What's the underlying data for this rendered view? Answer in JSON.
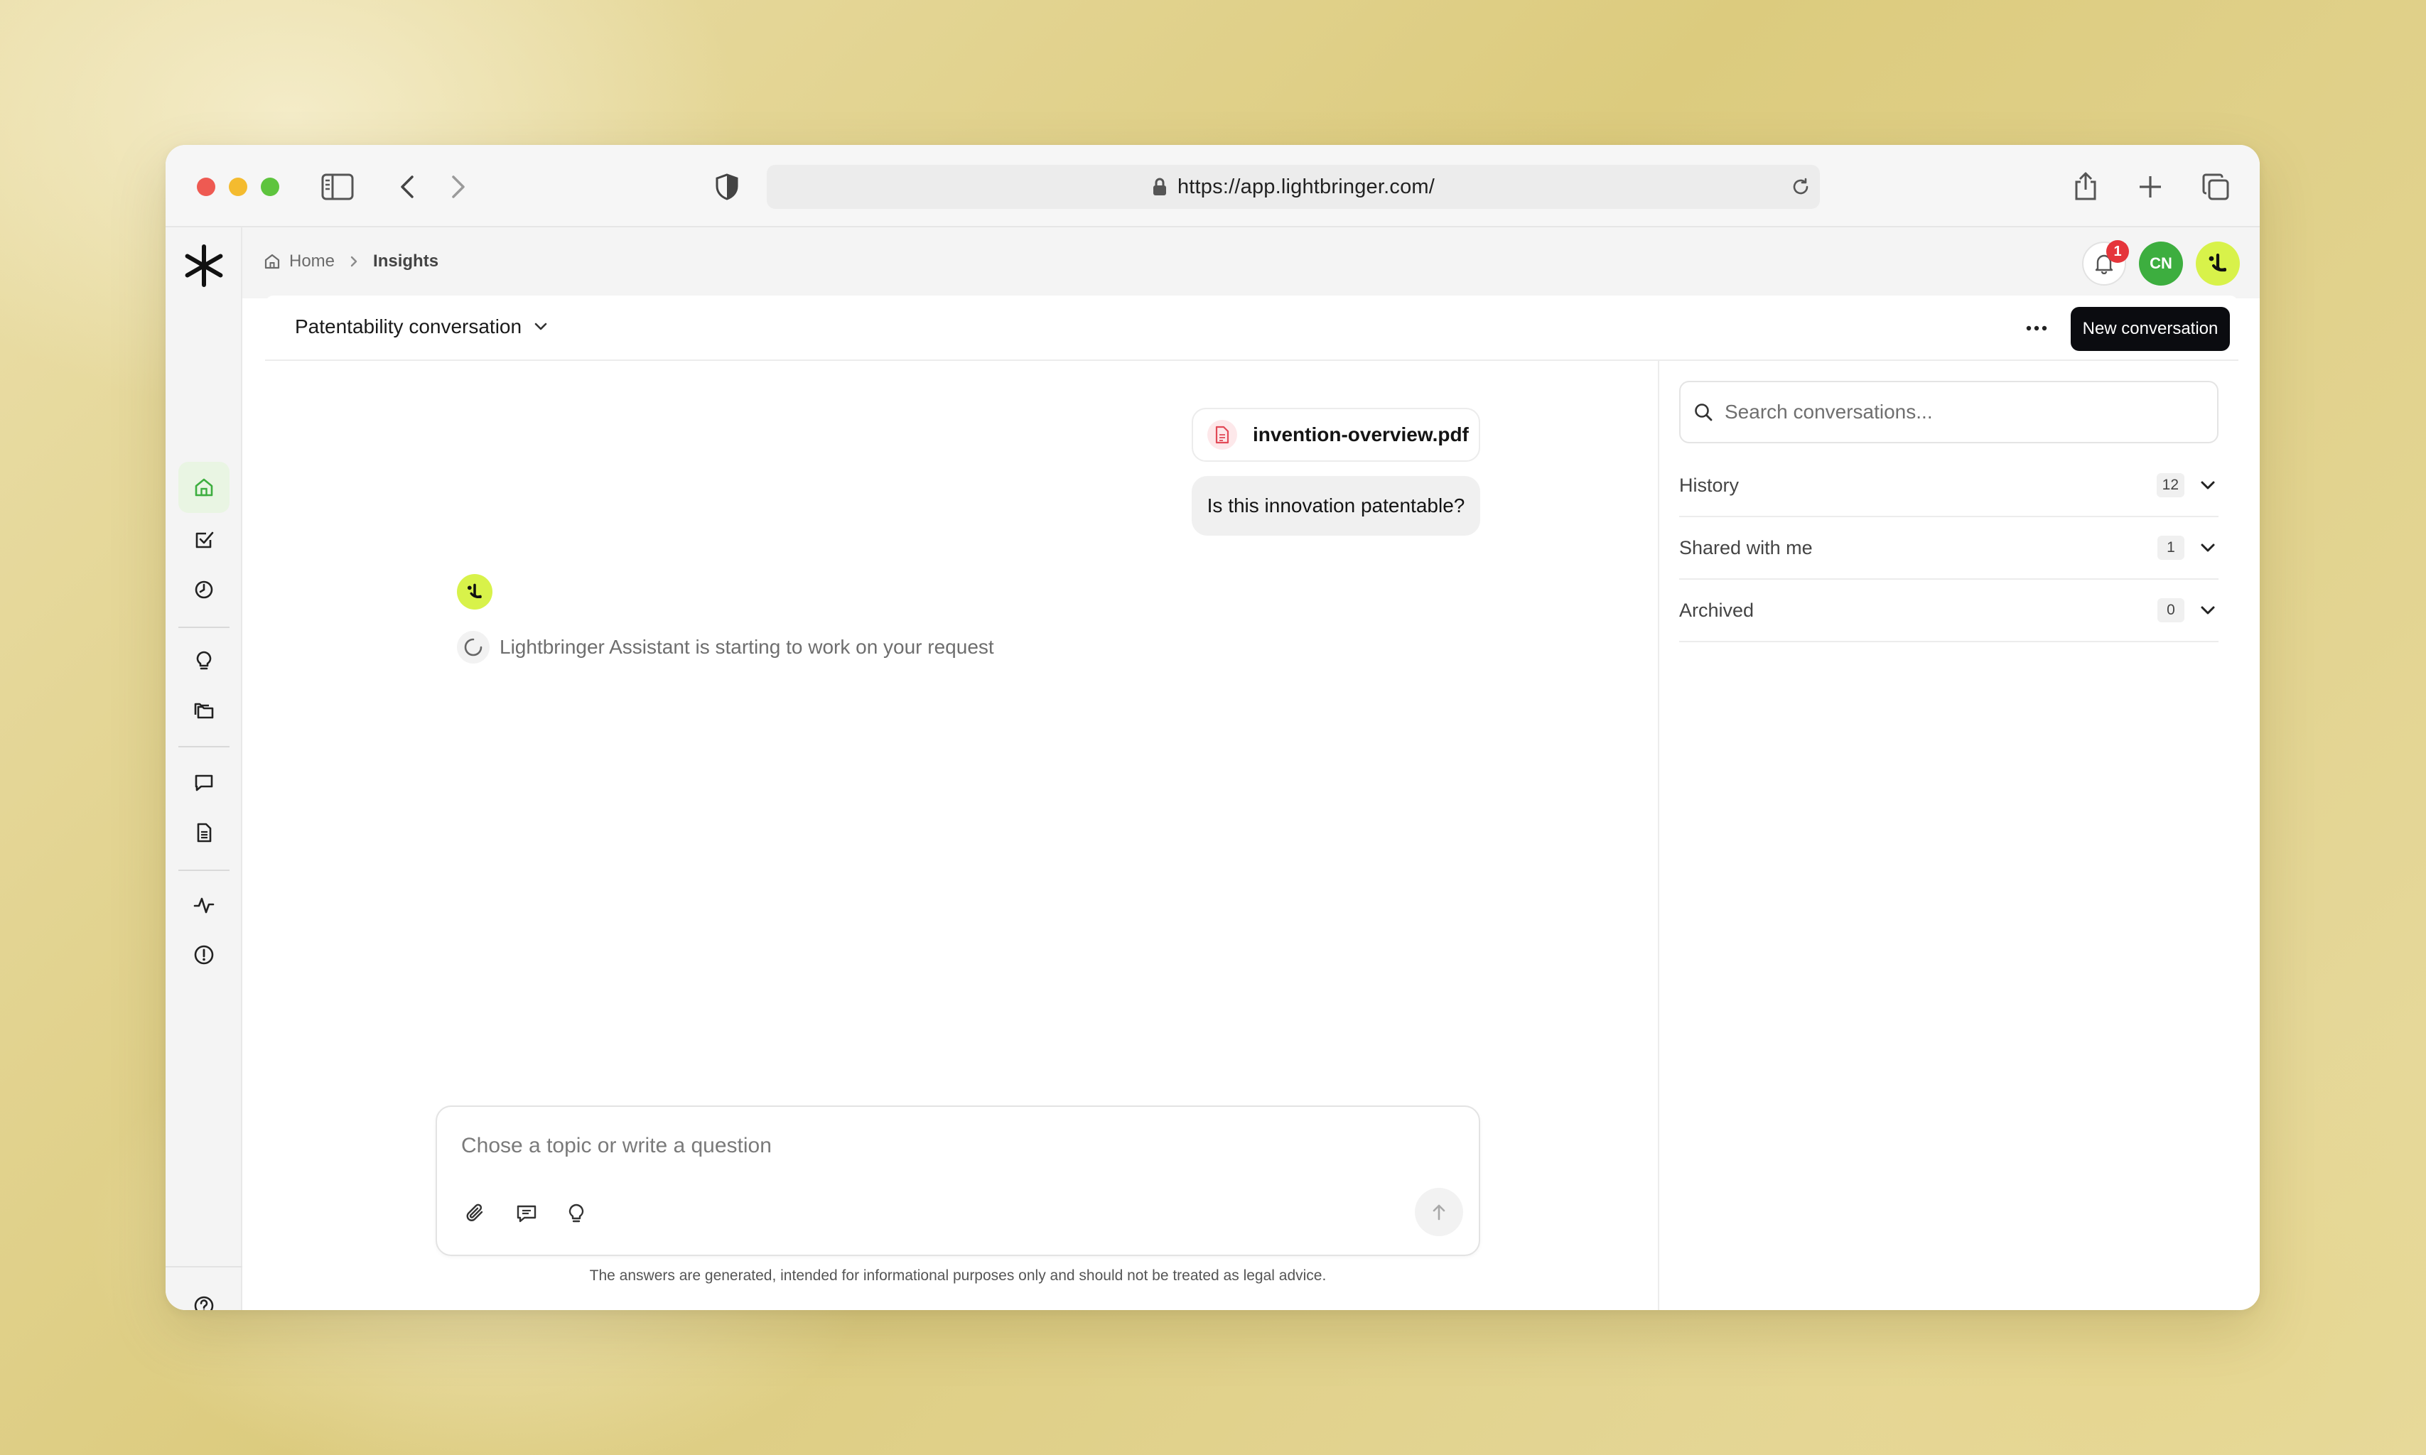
{
  "browser": {
    "url": "https://app.lightbringer.com/"
  },
  "breadcrumb": {
    "home": "Home",
    "current": "Insights"
  },
  "header": {
    "notification_count": "1",
    "user_initials": "CN"
  },
  "conversation": {
    "title": "Patentability conversation",
    "new_button": "New conversation"
  },
  "chat": {
    "attachment_name": "invention-overview.pdf",
    "user_message": "Is this innovation patentable?",
    "assistant_status": "Lightbringer Assistant is starting to work on your request"
  },
  "composer": {
    "placeholder": "Chose a topic or write a question",
    "disclaimer": "The answers are generated, intended for informational purposes only and should not be treated as legal advice."
  },
  "sidepanel": {
    "search_placeholder": "Search conversations...",
    "sections": [
      {
        "label": "History",
        "count": "12"
      },
      {
        "label": "Shared with me",
        "count": "1"
      },
      {
        "label": "Archived",
        "count": "0"
      }
    ]
  },
  "colors": {
    "accent_green": "#3dae3f",
    "brand_lime": "#d8f24a",
    "badge_red": "#e5353b",
    "button_dark": "#0b0c10"
  },
  "icons": {
    "rail": [
      "home-icon",
      "tasks-check-icon",
      "clock-icon",
      "lightbulb-icon",
      "folders-icon",
      "chat-icon",
      "document-icon",
      "activity-icon",
      "alert-icon",
      "help-icon",
      "settings-icon",
      "collapse-icon"
    ]
  }
}
